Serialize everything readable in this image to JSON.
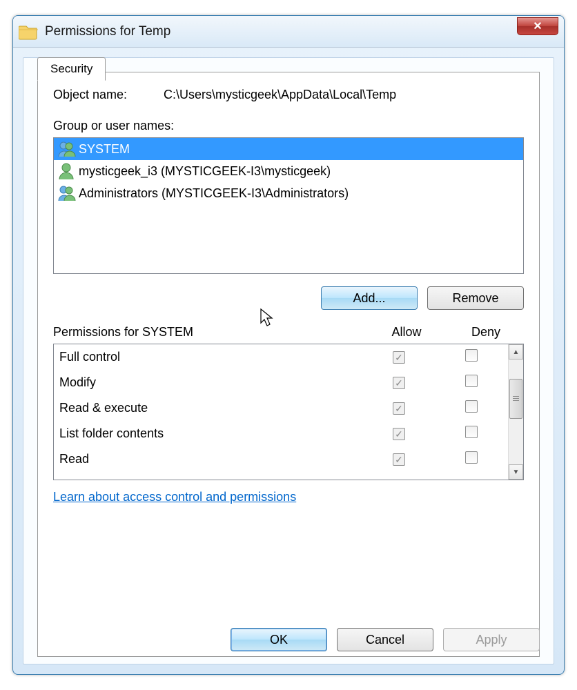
{
  "window": {
    "title": "Permissions for Temp"
  },
  "tab": {
    "label": "Security"
  },
  "object": {
    "label": "Object name:",
    "path": "C:\\Users\\mysticgeek\\AppData\\Local\\Temp"
  },
  "group_label": "Group or user names:",
  "users": [
    {
      "name": "SYSTEM",
      "icon": "group",
      "selected": true
    },
    {
      "name": "mysticgeek_i3 (MYSTICGEEK-I3\\mysticgeek)",
      "icon": "user",
      "selected": false
    },
    {
      "name": "Administrators (MYSTICGEEK-I3\\Administrators)",
      "icon": "group",
      "selected": false
    }
  ],
  "buttons": {
    "add": "Add...",
    "remove": "Remove",
    "ok": "OK",
    "cancel": "Cancel",
    "apply": "Apply"
  },
  "perm_header": {
    "title": "Permissions for SYSTEM",
    "allow": "Allow",
    "deny": "Deny"
  },
  "permissions": [
    {
      "name": "Full control",
      "allow": true,
      "deny": false
    },
    {
      "name": "Modify",
      "allow": true,
      "deny": false
    },
    {
      "name": "Read & execute",
      "allow": true,
      "deny": false
    },
    {
      "name": "List folder contents",
      "allow": true,
      "deny": false
    },
    {
      "name": "Read",
      "allow": true,
      "deny": false
    }
  ],
  "link": "Learn about access control and permissions"
}
